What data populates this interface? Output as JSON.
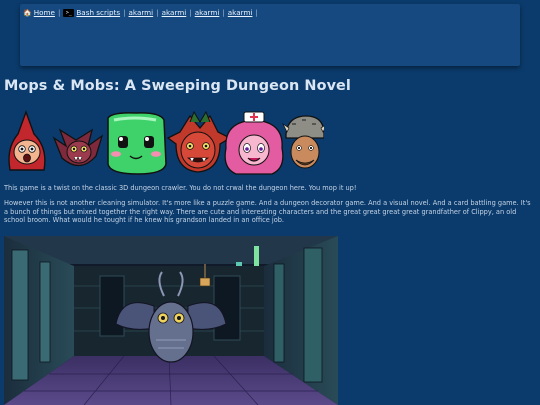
{
  "nav": {
    "home_label": "Home",
    "bash_label": "Bash scripts",
    "crumbs": [
      "akarmi",
      "akarmi",
      "akarmi",
      "akarmi"
    ],
    "separator": "|"
  },
  "page": {
    "title": "Mops & Mobs: A Sweeping Dungeon Novel",
    "para1": "This game is a twist on the classic 3D dungeon crawler. You do not crwal the dungeon here. You mop it up!",
    "para2": "However this is not another cleaning simulator. It's more like a puzzle game. And a dungeon decorator game. And a visual novel. And a card battling game. It's a bunch of things but mixed together the right way. There are cute and interesting characters and the great great great great grandfather of Clippy, an old school broom. What would he tought if he knew his grandson landed in an office job."
  },
  "colors": {
    "background": "#0b3b6c",
    "topbar": "#15497f",
    "title": "#dbe6f3"
  },
  "icons": {
    "home": "home-icon",
    "bash": "terminal-icon"
  }
}
